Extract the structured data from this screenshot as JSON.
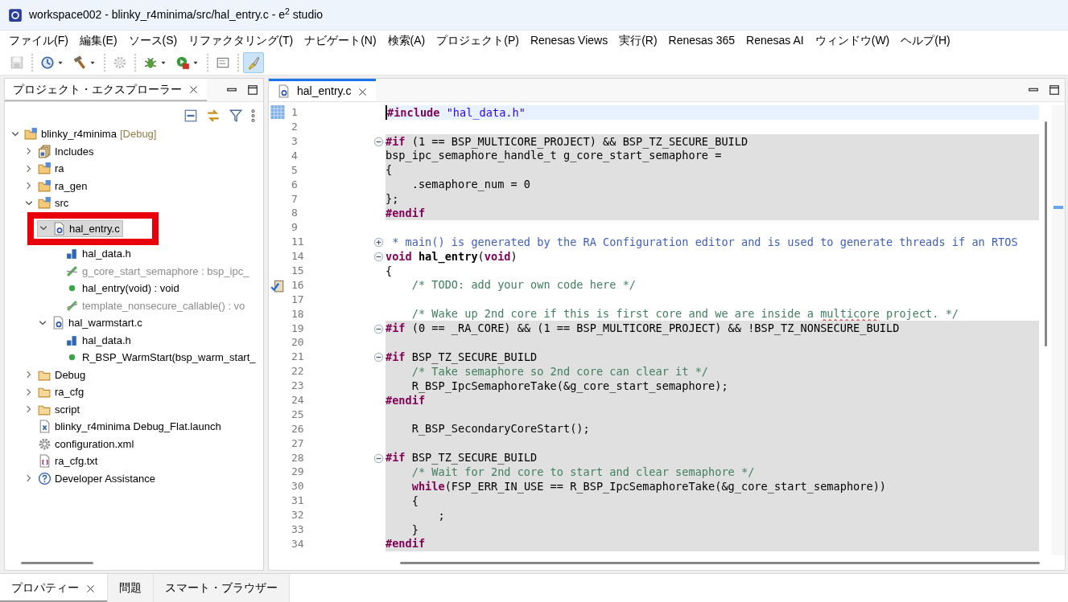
{
  "window": {
    "title": "workspace002 - blinky_r4minima/src/hal_entry.c - e$^{2}$ studio"
  },
  "menu": [
    "ファイル(F)",
    "編集(E)",
    "ソース(S)",
    "リファクタリング(T)",
    "ナビゲート(N)",
    "検索(A)",
    "プロジェクト(P)",
    "Renesas Views",
    "実行(R)",
    "Renesas 365",
    "Renesas AI",
    "ウィンドウ(W)",
    "ヘルプ(H)"
  ],
  "toolbar": [
    {
      "kind": "save",
      "disabled": true,
      "dropdown": false,
      "pressed": false
    },
    {
      "kind": "separator"
    },
    {
      "kind": "history",
      "disabled": false,
      "dropdown": true,
      "pressed": false
    },
    {
      "kind": "hammer",
      "disabled": false,
      "dropdown": true,
      "pressed": false
    },
    {
      "kind": "separator"
    },
    {
      "kind": "gear",
      "disabled": true,
      "dropdown": false,
      "pressed": false
    },
    {
      "kind": "separator"
    },
    {
      "kind": "bug",
      "disabled": false,
      "dropdown": true,
      "pressed": false
    },
    {
      "kind": "run",
      "disabled": false,
      "dropdown": true,
      "pressed": false
    },
    {
      "kind": "separator"
    },
    {
      "kind": "console",
      "disabled": false,
      "dropdown": false,
      "pressed": false
    },
    {
      "kind": "separator"
    },
    {
      "kind": "brush",
      "disabled": false,
      "dropdown": false,
      "pressed": true
    }
  ],
  "explorer": {
    "tab": {
      "label": "プロジェクト・エクスプローラー",
      "selected": true
    },
    "tree": [
      {
        "kind": "project",
        "label": "blinky_r4minima",
        "suffix": "[Debug]",
        "expanded": true,
        "selected": false,
        "children": [
          {
            "kind": "includes",
            "label": "Includes",
            "expanded": false,
            "selected": false
          },
          {
            "kind": "source-folder",
            "label": "ra",
            "expanded": false,
            "selected": false
          },
          {
            "kind": "source-folder",
            "label": "ra_gen",
            "expanded": false,
            "selected": false
          },
          {
            "kind": "source-folder",
            "label": "src",
            "expanded": true,
            "selected": false,
            "children": [
              {
                "kind": "c-file",
                "label": "hal_entry.c",
                "expanded": true,
                "selected": true,
                "highlighted": true,
                "children": [
                  {
                    "kind": "header",
                    "label": "hal_data.h",
                    "selected": false,
                    "dimmed": false
                  },
                  {
                    "kind": "variable",
                    "label": "g_core_start_semaphore : bsp_ipc_",
                    "selected": false,
                    "dimmed": true
                  },
                  {
                    "kind": "function",
                    "label": "hal_entry(void) : void",
                    "selected": false,
                    "dimmed": false
                  },
                  {
                    "kind": "secure-function",
                    "label": "template_nonsecure_callable() : vo",
                    "selected": false,
                    "dimmed": true
                  }
                ]
              },
              {
                "kind": "c-file",
                "label": "hal_warmstart.c",
                "expanded": true,
                "selected": false,
                "children": [
                  {
                    "kind": "header",
                    "label": "hal_data.h",
                    "selected": false,
                    "dimmed": false
                  },
                  {
                    "kind": "function",
                    "label": "R_BSP_WarmStart(bsp_warm_start_",
                    "selected": false,
                    "dimmed": false
                  }
                ]
              }
            ]
          },
          {
            "kind": "folder",
            "label": "Debug",
            "expanded": false,
            "selected": false
          },
          {
            "kind": "folder",
            "label": "ra_cfg",
            "expanded": false,
            "selected": false
          },
          {
            "kind": "folder",
            "label": "script",
            "expanded": false,
            "selected": false
          },
          {
            "kind": "launch",
            "label": "blinky_r4minima Debug_Flat.launch",
            "selected": false
          },
          {
            "kind": "config",
            "label": "configuration.xml",
            "selected": false
          },
          {
            "kind": "text",
            "label": "ra_cfg.txt",
            "selected": false
          },
          {
            "kind": "help",
            "label": "Developer Assistance",
            "expanded": false,
            "selected": false
          }
        ]
      }
    ]
  },
  "editor": {
    "tab": {
      "label": "hal_entry.c",
      "selected": true
    },
    "lines": [
      {
        "number": "1",
        "current": true,
        "inactive": false,
        "tokens": [
          {
            "kind": "directive",
            "text": "#include"
          },
          {
            "kind": "string",
            "text": " \"hal_data.h\""
          }
        ]
      },
      {
        "number": "2",
        "current": false,
        "inactive": false
      },
      {
        "number": "3",
        "current": false,
        "inactive": true,
        "folded": false,
        "tokens": [
          {
            "kind": "directive",
            "text": "#if"
          },
          {
            "kind": "plain",
            "text": " (1 == BSP_MULTICORE_PROJECT) && BSP_TZ_SECURE_BUILD"
          }
        ]
      },
      {
        "number": "4",
        "current": false,
        "inactive": true,
        "tokens": [
          {
            "kind": "plain",
            "text": "bsp_ipc_semaphore_handle_t g_core_start_semaphore ="
          }
        ]
      },
      {
        "number": "5",
        "current": false,
        "inactive": true,
        "tokens": [
          {
            "kind": "plain",
            "text": "{"
          }
        ]
      },
      {
        "number": "6",
        "current": false,
        "inactive": true,
        "tokens": [
          {
            "kind": "plain",
            "text": "    .semaphore_num = 0"
          }
        ]
      },
      {
        "number": "7",
        "current": false,
        "inactive": true,
        "tokens": [
          {
            "kind": "plain",
            "text": "};"
          }
        ]
      },
      {
        "number": "8",
        "current": false,
        "inactive": true,
        "tokens": [
          {
            "kind": "directive",
            "text": "#endif"
          }
        ]
      },
      {
        "number": "9",
        "current": false,
        "inactive": false
      },
      {
        "number": "11",
        "current": false,
        "inactive": false,
        "folded": true,
        "tokens": [
          {
            "kind": "doc",
            "text": " * main() is generated by the RA Configuration editor and is used to generate threads if an RTOS"
          }
        ]
      },
      {
        "number": "14",
        "current": false,
        "inactive": false,
        "folded": false,
        "tokens": [
          {
            "kind": "keyword",
            "text": "void"
          },
          {
            "kind": "bold",
            "text": " hal_entry"
          },
          {
            "kind": "plain",
            "text": "("
          },
          {
            "kind": "keyword",
            "text": "void"
          },
          {
            "kind": "plain",
            "text": ")"
          }
        ]
      },
      {
        "number": "15",
        "current": false,
        "inactive": false,
        "tokens": [
          {
            "kind": "plain",
            "text": "{"
          }
        ]
      },
      {
        "number": "16",
        "current": false,
        "inactive": false,
        "task": true,
        "tokens": [
          {
            "kind": "comment",
            "text": "    /* TODO: add your own code here */"
          }
        ]
      },
      {
        "number": "17",
        "current": false,
        "inactive": false
      },
      {
        "number": "18",
        "current": false,
        "inactive": false,
        "tokens": [
          {
            "kind": "comment",
            "text": "    /* Wake up 2nd core if this is first core and we are inside a "
          },
          {
            "kind": "misspelled",
            "text": "multicore"
          },
          {
            "kind": "comment",
            "text": " project. */"
          }
        ]
      },
      {
        "number": "19",
        "current": false,
        "inactive": true,
        "folded": false,
        "tokens": [
          {
            "kind": "directive",
            "text": "#if"
          },
          {
            "kind": "plain",
            "text": " (0 == _RA_CORE) && (1 == BSP_MULTICORE_PROJECT) && !BSP_TZ_NONSECURE_BUILD"
          }
        ]
      },
      {
        "number": "20",
        "current": false,
        "inactive": true
      },
      {
        "number": "21",
        "current": false,
        "inactive": true,
        "folded": false,
        "tokens": [
          {
            "kind": "directive",
            "text": "#if"
          },
          {
            "kind": "plain",
            "text": " BSP_TZ_SECURE_BUILD"
          }
        ]
      },
      {
        "number": "22",
        "current": false,
        "inactive": true,
        "tokens": [
          {
            "kind": "comment",
            "text": "    /* Take semaphore so 2nd core can clear it */"
          }
        ]
      },
      {
        "number": "23",
        "current": false,
        "inactive": true,
        "tokens": [
          {
            "kind": "plain",
            "text": "    R_BSP_IpcSemaphoreTake(&g_core_start_semaphore);"
          }
        ]
      },
      {
        "number": "24",
        "current": false,
        "inactive": true,
        "tokens": [
          {
            "kind": "directive",
            "text": "#endif"
          }
        ]
      },
      {
        "number": "25",
        "current": false,
        "inactive": true
      },
      {
        "number": "26",
        "current": false,
        "inactive": true,
        "tokens": [
          {
            "kind": "plain",
            "text": "    R_BSP_SecondaryCoreStart();"
          }
        ]
      },
      {
        "number": "27",
        "current": false,
        "inactive": true
      },
      {
        "number": "28",
        "current": false,
        "inactive": true,
        "folded": false,
        "tokens": [
          {
            "kind": "directive",
            "text": "#if"
          },
          {
            "kind": "plain",
            "text": " BSP_TZ_SECURE_BUILD"
          }
        ]
      },
      {
        "number": "29",
        "current": false,
        "inactive": true,
        "tokens": [
          {
            "kind": "comment",
            "text": "    /* Wait for 2nd core to start and clear semaphore */"
          }
        ]
      },
      {
        "number": "30",
        "current": false,
        "inactive": true,
        "tokens": [
          {
            "kind": "keyword",
            "text": "    while"
          },
          {
            "kind": "plain",
            "text": "(FSP_ERR_IN_USE == R_BSP_IpcSemaphoreTake(&g_core_start_semaphore))"
          }
        ]
      },
      {
        "number": "31",
        "current": false,
        "inactive": true,
        "tokens": [
          {
            "kind": "plain",
            "text": "    {"
          }
        ]
      },
      {
        "number": "32",
        "current": false,
        "inactive": true,
        "tokens": [
          {
            "kind": "plain",
            "text": "        ;"
          }
        ]
      },
      {
        "number": "33",
        "current": false,
        "inactive": true,
        "tokens": [
          {
            "kind": "plain",
            "text": "    }"
          }
        ]
      },
      {
        "number": "34",
        "current": false,
        "inactive": true,
        "tokens": [
          {
            "kind": "directive",
            "text": "#endif"
          }
        ]
      }
    ]
  },
  "bottom_tabs": [
    {
      "label": "プロパティー",
      "selected": true,
      "closable": true
    },
    {
      "label": "問題",
      "selected": false,
      "closable": false
    },
    {
      "label": "スマート・ブラウザー",
      "selected": false,
      "closable": false
    }
  ]
}
